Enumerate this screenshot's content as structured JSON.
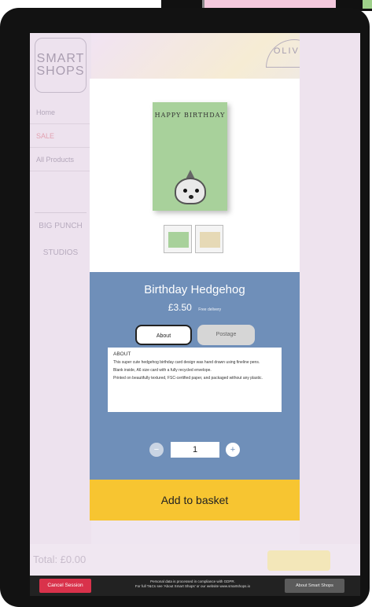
{
  "store": {
    "logo": "SMART\nSHOPS",
    "menu": [
      "Home",
      "SALE",
      "All Products"
    ],
    "banner_text": "OLIVER",
    "brands": [
      "BIG PUNCH STUDIOS"
    ],
    "total": "Total: £0.00"
  },
  "product": {
    "card_title": "HAPPY BIRTHDAY",
    "name": "Birthday Hedgehog",
    "price": "£3.50",
    "delivery": "Free delivery",
    "tabs": {
      "about": "About",
      "postage": "Postage"
    },
    "about_heading": "ABOUT",
    "about_lines": [
      "This super cute hedgehog birthday card design was hand drawn using fineline pens.",
      "Blank inside, A6 size card with a fully recycled envelope.",
      "Printed on beautifully textured, FSC-certified paper, and packaged without any plastic."
    ],
    "quantity": "1",
    "add_to_basket": "Add to basket"
  },
  "footer": {
    "cancel": "Cancel Session",
    "gdpr": "Personal data is processed in compliance with GDPR.\nFor full T&Cs see 'About Smart Shops' or our website www.smartshops.io",
    "about": "About Smart Shops"
  },
  "colors": {
    "info_bg": "#6f8fb9",
    "basket_btn": "#f7c531",
    "cancel_btn": "#d9324b"
  }
}
